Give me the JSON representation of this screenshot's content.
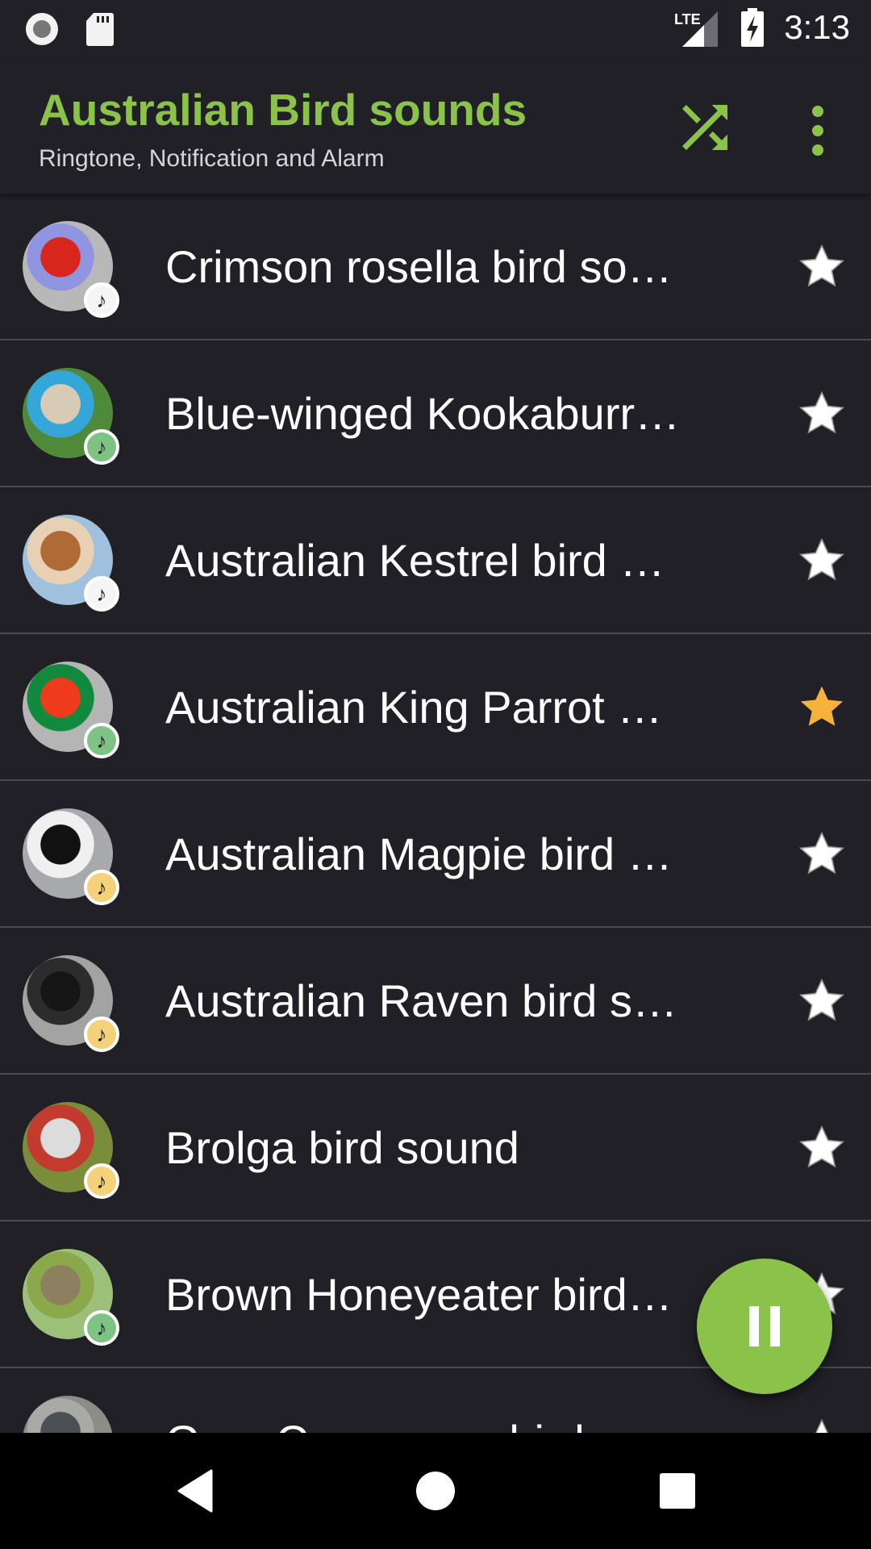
{
  "status_bar": {
    "time": "3:13",
    "network": "LTE",
    "left_icons": [
      "record-icon",
      "sd-card-icon"
    ],
    "right_icons": [
      "lte-signal-icon",
      "battery-charging-icon"
    ]
  },
  "app_bar": {
    "title": "Australian Bird sounds",
    "subtitle": "Ringtone, Notification and Alarm",
    "actions": [
      "shuffle-icon",
      "more-vert-icon"
    ],
    "accent_color": "#8bc34a"
  },
  "sounds": [
    {
      "title": "Crimson rosella bird so…",
      "badge_color": "#f5f5f5",
      "favorite": false,
      "avatar_colors": [
        "#d9261c",
        "#8f95e0",
        "#b8b8b8"
      ]
    },
    {
      "title": "Blue-winged Kookaburr…",
      "badge_color": "#7dc383",
      "favorite": false,
      "avatar_colors": [
        "#d8cbb6",
        "#35a6d8",
        "#4f8a3a"
      ]
    },
    {
      "title": "Australian Kestrel bird …",
      "badge_color": "#f5f5f5",
      "favorite": false,
      "avatar_colors": [
        "#b06a36",
        "#e7d0b4",
        "#9fc1de"
      ]
    },
    {
      "title": "Australian King Parrot …",
      "badge_color": "#7dc383",
      "favorite": true,
      "avatar_colors": [
        "#ee3b1c",
        "#118a3e",
        "#b5b5b5"
      ]
    },
    {
      "title": "Australian Magpie bird …",
      "badge_color": "#f5d27a",
      "favorite": false,
      "avatar_colors": [
        "#111111",
        "#f0f0f0",
        "#a7a9ac"
      ]
    },
    {
      "title": "Australian Raven bird s…",
      "badge_color": "#f5d27a",
      "favorite": false,
      "avatar_colors": [
        "#161616",
        "#2c2c2c",
        "#a3a3a3"
      ]
    },
    {
      "title": "Brolga bird sound",
      "badge_color": "#f5d27a",
      "favorite": false,
      "avatar_colors": [
        "#dcdcdc",
        "#c33b2e",
        "#7a8d3b"
      ]
    },
    {
      "title": "Brown Honeyeater bird…",
      "badge_color": "#7dc383",
      "favorite": false,
      "avatar_colors": [
        "#8c8060",
        "#8aa94a",
        "#9cc07a"
      ]
    },
    {
      "title": "Grey Currawong bird s…",
      "badge_color": "#7dc383",
      "favorite": false,
      "avatar_colors": [
        "#4c4f54",
        "#a9aaa6",
        "#8d8d88"
      ]
    }
  ],
  "colors": {
    "background": "#212026",
    "divider": "#4a494f",
    "star_off": "#ffffff",
    "star_on": "#f6b23b",
    "fab": "#8bc34a"
  },
  "player": {
    "state_icon": "pause-icon",
    "state": "playing"
  },
  "nav_bar": {
    "buttons": [
      "back-icon",
      "home-icon",
      "recents-icon"
    ]
  }
}
